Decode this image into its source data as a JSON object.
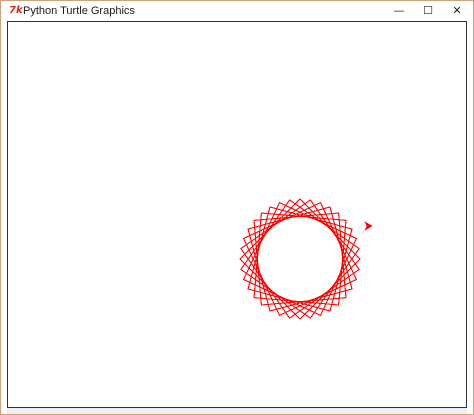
{
  "window": {
    "title": "Python Turtle Graphics",
    "icon": "tk-feather-icon",
    "controls": {
      "minimize": "—",
      "maximize": "☐",
      "close": "✕"
    }
  },
  "drawing": {
    "pen_color": "#ff0000",
    "pattern": "star-polygon-rosette",
    "turtle_shape": "arrow"
  }
}
